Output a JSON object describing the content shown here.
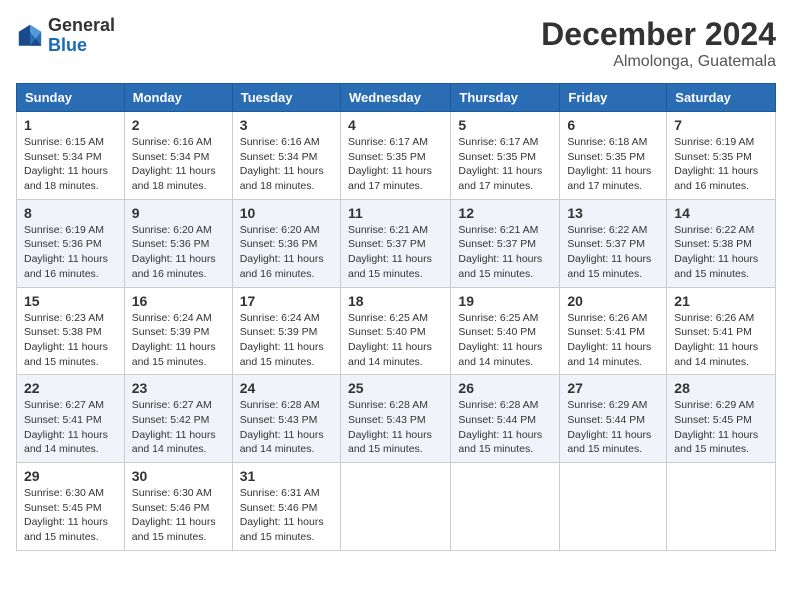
{
  "logo": {
    "general": "General",
    "blue": "Blue"
  },
  "title": {
    "month": "December 2024",
    "location": "Almolonga, Guatemala"
  },
  "headers": [
    "Sunday",
    "Monday",
    "Tuesday",
    "Wednesday",
    "Thursday",
    "Friday",
    "Saturday"
  ],
  "weeks": [
    [
      {
        "day": "1",
        "sunrise": "Sunrise: 6:15 AM",
        "sunset": "Sunset: 5:34 PM",
        "daylight": "Daylight: 11 hours and 18 minutes."
      },
      {
        "day": "2",
        "sunrise": "Sunrise: 6:16 AM",
        "sunset": "Sunset: 5:34 PM",
        "daylight": "Daylight: 11 hours and 18 minutes."
      },
      {
        "day": "3",
        "sunrise": "Sunrise: 6:16 AM",
        "sunset": "Sunset: 5:34 PM",
        "daylight": "Daylight: 11 hours and 18 minutes."
      },
      {
        "day": "4",
        "sunrise": "Sunrise: 6:17 AM",
        "sunset": "Sunset: 5:35 PM",
        "daylight": "Daylight: 11 hours and 17 minutes."
      },
      {
        "day": "5",
        "sunrise": "Sunrise: 6:17 AM",
        "sunset": "Sunset: 5:35 PM",
        "daylight": "Daylight: 11 hours and 17 minutes."
      },
      {
        "day": "6",
        "sunrise": "Sunrise: 6:18 AM",
        "sunset": "Sunset: 5:35 PM",
        "daylight": "Daylight: 11 hours and 17 minutes."
      },
      {
        "day": "7",
        "sunrise": "Sunrise: 6:19 AM",
        "sunset": "Sunset: 5:35 PM",
        "daylight": "Daylight: 11 hours and 16 minutes."
      }
    ],
    [
      {
        "day": "8",
        "sunrise": "Sunrise: 6:19 AM",
        "sunset": "Sunset: 5:36 PM",
        "daylight": "Daylight: 11 hours and 16 minutes."
      },
      {
        "day": "9",
        "sunrise": "Sunrise: 6:20 AM",
        "sunset": "Sunset: 5:36 PM",
        "daylight": "Daylight: 11 hours and 16 minutes."
      },
      {
        "day": "10",
        "sunrise": "Sunrise: 6:20 AM",
        "sunset": "Sunset: 5:36 PM",
        "daylight": "Daylight: 11 hours and 16 minutes."
      },
      {
        "day": "11",
        "sunrise": "Sunrise: 6:21 AM",
        "sunset": "Sunset: 5:37 PM",
        "daylight": "Daylight: 11 hours and 15 minutes."
      },
      {
        "day": "12",
        "sunrise": "Sunrise: 6:21 AM",
        "sunset": "Sunset: 5:37 PM",
        "daylight": "Daylight: 11 hours and 15 minutes."
      },
      {
        "day": "13",
        "sunrise": "Sunrise: 6:22 AM",
        "sunset": "Sunset: 5:37 PM",
        "daylight": "Daylight: 11 hours and 15 minutes."
      },
      {
        "day": "14",
        "sunrise": "Sunrise: 6:22 AM",
        "sunset": "Sunset: 5:38 PM",
        "daylight": "Daylight: 11 hours and 15 minutes."
      }
    ],
    [
      {
        "day": "15",
        "sunrise": "Sunrise: 6:23 AM",
        "sunset": "Sunset: 5:38 PM",
        "daylight": "Daylight: 11 hours and 15 minutes."
      },
      {
        "day": "16",
        "sunrise": "Sunrise: 6:24 AM",
        "sunset": "Sunset: 5:39 PM",
        "daylight": "Daylight: 11 hours and 15 minutes."
      },
      {
        "day": "17",
        "sunrise": "Sunrise: 6:24 AM",
        "sunset": "Sunset: 5:39 PM",
        "daylight": "Daylight: 11 hours and 15 minutes."
      },
      {
        "day": "18",
        "sunrise": "Sunrise: 6:25 AM",
        "sunset": "Sunset: 5:40 PM",
        "daylight": "Daylight: 11 hours and 14 minutes."
      },
      {
        "day": "19",
        "sunrise": "Sunrise: 6:25 AM",
        "sunset": "Sunset: 5:40 PM",
        "daylight": "Daylight: 11 hours and 14 minutes."
      },
      {
        "day": "20",
        "sunrise": "Sunrise: 6:26 AM",
        "sunset": "Sunset: 5:41 PM",
        "daylight": "Daylight: 11 hours and 14 minutes."
      },
      {
        "day": "21",
        "sunrise": "Sunrise: 6:26 AM",
        "sunset": "Sunset: 5:41 PM",
        "daylight": "Daylight: 11 hours and 14 minutes."
      }
    ],
    [
      {
        "day": "22",
        "sunrise": "Sunrise: 6:27 AM",
        "sunset": "Sunset: 5:41 PM",
        "daylight": "Daylight: 11 hours and 14 minutes."
      },
      {
        "day": "23",
        "sunrise": "Sunrise: 6:27 AM",
        "sunset": "Sunset: 5:42 PM",
        "daylight": "Daylight: 11 hours and 14 minutes."
      },
      {
        "day": "24",
        "sunrise": "Sunrise: 6:28 AM",
        "sunset": "Sunset: 5:43 PM",
        "daylight": "Daylight: 11 hours and 14 minutes."
      },
      {
        "day": "25",
        "sunrise": "Sunrise: 6:28 AM",
        "sunset": "Sunset: 5:43 PM",
        "daylight": "Daylight: 11 hours and 15 minutes."
      },
      {
        "day": "26",
        "sunrise": "Sunrise: 6:28 AM",
        "sunset": "Sunset: 5:44 PM",
        "daylight": "Daylight: 11 hours and 15 minutes."
      },
      {
        "day": "27",
        "sunrise": "Sunrise: 6:29 AM",
        "sunset": "Sunset: 5:44 PM",
        "daylight": "Daylight: 11 hours and 15 minutes."
      },
      {
        "day": "28",
        "sunrise": "Sunrise: 6:29 AM",
        "sunset": "Sunset: 5:45 PM",
        "daylight": "Daylight: 11 hours and 15 minutes."
      }
    ],
    [
      {
        "day": "29",
        "sunrise": "Sunrise: 6:30 AM",
        "sunset": "Sunset: 5:45 PM",
        "daylight": "Daylight: 11 hours and 15 minutes."
      },
      {
        "day": "30",
        "sunrise": "Sunrise: 6:30 AM",
        "sunset": "Sunset: 5:46 PM",
        "daylight": "Daylight: 11 hours and 15 minutes."
      },
      {
        "day": "31",
        "sunrise": "Sunrise: 6:31 AM",
        "sunset": "Sunset: 5:46 PM",
        "daylight": "Daylight: 11 hours and 15 minutes."
      },
      null,
      null,
      null,
      null
    ]
  ]
}
